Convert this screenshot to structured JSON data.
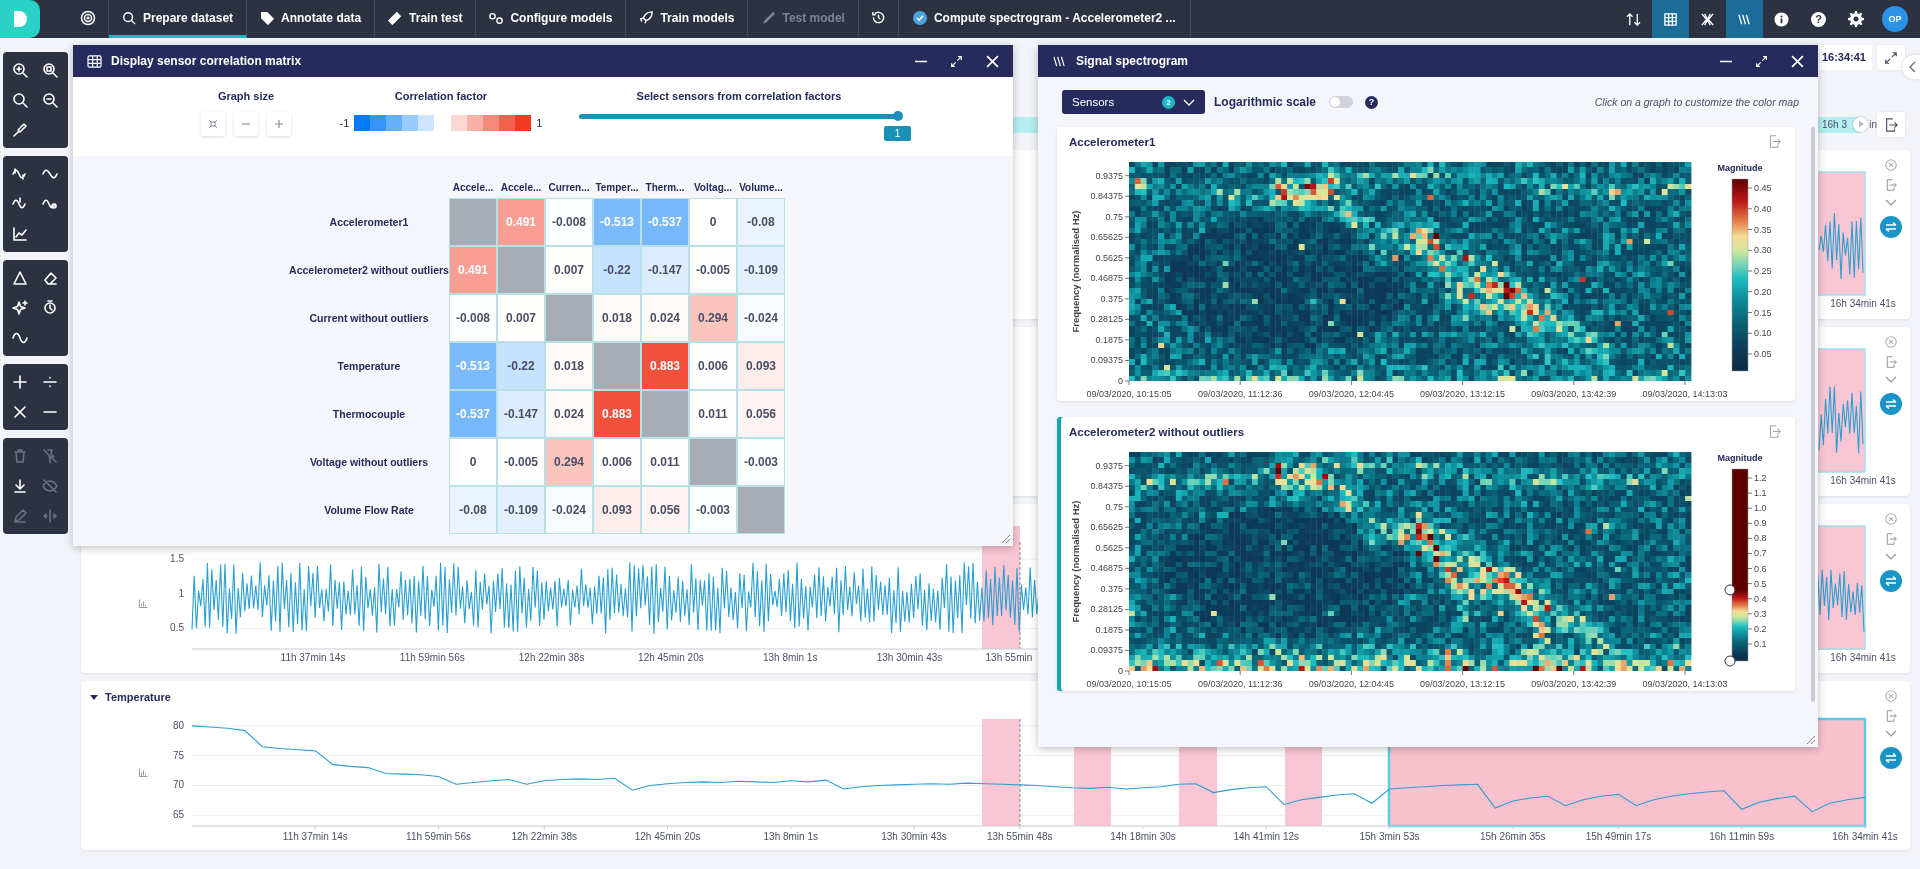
{
  "nav": {
    "items": [
      {
        "label": "Prepare dataset",
        "selected": true,
        "disabled": false
      },
      {
        "label": "Annotate data",
        "selected": false,
        "disabled": false
      },
      {
        "label": "Train test",
        "selected": false,
        "disabled": false
      },
      {
        "label": "Configure models",
        "selected": false,
        "disabled": false
      },
      {
        "label": "Train models",
        "selected": false,
        "disabled": false
      },
      {
        "label": "Test model",
        "selected": false,
        "disabled": true
      }
    ],
    "task": "Compute spectrogram - Accelerometer2 ...",
    "tools": [
      {
        "selected": false
      },
      {
        "selected": true
      },
      {
        "selected": false
      },
      {
        "selected": true
      }
    ],
    "help": "?",
    "avatar": "OP"
  },
  "toolbar": {
    "groups": [
      {
        "tools": [
          {
            "disabled": false
          },
          {
            "disabled": false
          },
          {
            "disabled": false
          },
          {
            "disabled": false
          },
          {
            "disabled": false
          }
        ]
      },
      {
        "tools": [
          {
            "disabled": false
          },
          {
            "disabled": false
          },
          {
            "disabled": false
          },
          {
            "disabled": false
          },
          {
            "disabled": false
          }
        ]
      },
      {
        "tools": [
          {
            "disabled": false
          },
          {
            "disabled": false
          },
          {
            "disabled": false
          },
          {
            "disabled": false
          },
          {
            "disabled": false
          }
        ]
      },
      {
        "tools": [
          {
            "disabled": false
          },
          {
            "disabled": false
          },
          {
            "disabled": false
          },
          {
            "disabled": false
          }
        ]
      },
      {
        "tools": [
          {
            "disabled": true
          },
          {
            "disabled": true
          },
          {
            "disabled": false
          },
          {
            "disabled": true
          },
          {
            "disabled": true
          },
          {
            "disabled": true
          }
        ]
      }
    ]
  },
  "header": {
    "date": "16:34:41",
    "timeline_labels": [
      "16h 3",
      "in"
    ],
    "timeline": {
      "level": 1
    }
  },
  "cards": [
    {
      "kind": "waveform",
      "end_label": "16h 34min 41s"
    },
    {
      "kind": "waveform",
      "end_label": "16h 34min 41s"
    },
    {
      "kind": "waveform",
      "y_labels": [
        "1.5",
        "1",
        "0.5"
      ],
      "x_labels": [
        "11h 37min 14s",
        "11h 59min 56s",
        "12h 22min 38s",
        "12h 45min 20s",
        "13h 8min 1s",
        "13h 30min 43s",
        "13h 55min"
      ],
      "end_label": "16h 34min 41s"
    },
    {
      "kind": "chart",
      "title": "Temperature",
      "expanded": true,
      "regions": [
        {
          "selected": false
        },
        {
          "selected": false
        },
        {
          "selected": false
        },
        {
          "selected": false
        },
        {
          "selected": true
        }
      ],
      "chart_data": {
        "type": "line",
        "ylim": [
          63.2,
          81.15
        ],
        "yticks": [
          80,
          75,
          70,
          65
        ],
        "grid": true,
        "categories": [
          null,
          null,
          null,
          null,
          null,
          null,
          null,
          "11h 37min 14s",
          null,
          null,
          null,
          null,
          null,
          null,
          "11h 59min 56s",
          null,
          null,
          null,
          null,
          null,
          "12h 22min 38s",
          null,
          null,
          null,
          null,
          null,
          null,
          "12h 45min 20s",
          null,
          null,
          null,
          null,
          null,
          null,
          "13h 8min 1s",
          null,
          null,
          null,
          null,
          null,
          null,
          "13h 30min 43s",
          null,
          null,
          null,
          null,
          null,
          "13h 55min 48s",
          null,
          null,
          null,
          null,
          null,
          null,
          "14h 18min 30s",
          null,
          null,
          null,
          null,
          null,
          null,
          "14h 41min 12s",
          null,
          null,
          null,
          null,
          null,
          null,
          "15h 3min 53s",
          null,
          null,
          null,
          null,
          null,
          null,
          "15h 26min 35s",
          null,
          null,
          null,
          null,
          null,
          "15h 49min 17s",
          null,
          null,
          null,
          null,
          null,
          null,
          "16h 11min 59s",
          null,
          null,
          null,
          null,
          null,
          null,
          "16h 34min 41s"
        ],
        "series": [
          {
            "values": [
              80,
              79.8,
              79.6,
              79.2,
              76.5,
              76.2,
              76,
              75.8,
              73.5,
              73.2,
              73,
              72,
              71.9,
              71.8,
              71.5,
              70.2,
              70.5,
              70.8,
              71,
              70.2,
              70.8,
              71,
              71.1,
              71,
              71.2,
              69.2,
              70,
              70.3,
              70.5,
              70.6,
              70.5,
              70.7,
              70.6,
              70.5,
              70.8,
              70.6,
              70.9,
              69.4,
              69.8,
              70,
              70.1,
              70.2,
              70.3,
              70.2,
              70.4,
              70.3,
              70.2,
              70.1,
              70,
              69.8,
              69.6,
              69.5,
              69.7,
              69.4,
              69.6,
              69.8,
              70.2,
              70.3,
              68.8,
              69.3,
              69.6,
              69.8,
              66.8,
              67.6,
              68,
              68.4,
              68.6,
              67,
              69.4,
              69.6,
              69.8,
              70,
              70.1,
              70.2,
              66.2,
              67.4,
              67.9,
              68.2,
              66.6,
              67.6,
              68.2,
              68.5,
              66.6,
              67.6,
              68.2,
              68.6,
              68.9,
              69.1,
              66,
              67.2,
              67.8,
              68.2,
              65.6,
              67,
              67.6,
              68
            ]
          }
        ]
      }
    }
  ],
  "correlation_window": {
    "title": "Display sensor correlation matrix",
    "graph_size_label": "Graph size",
    "factor_label": "Correlation factor",
    "legend_min": "-1",
    "legend_max": "1",
    "slider_label": "Select sensors from correlation factors",
    "slider": {
      "level": 1,
      "value": "1"
    },
    "columns": [
      "Accele...",
      "Accele...",
      "Curren...",
      "Temper...",
      "Therm...",
      "Voltag...",
      "Volume..."
    ],
    "rows": [
      {
        "label": "Accelerometer1",
        "cells": [
          null,
          "0.491",
          "-0.008",
          "-0.513",
          "-0.537",
          "0",
          "-0.08"
        ]
      },
      {
        "label": "Accelerometer2 without outliers",
        "cells": [
          "0.491",
          null,
          "0.007",
          "-0.22",
          "-0.147",
          "-0.005",
          "-0.109"
        ]
      },
      {
        "label": "Current without outliers",
        "cells": [
          "-0.008",
          "0.007",
          null,
          "0.018",
          "0.024",
          "0.294",
          "-0.024"
        ]
      },
      {
        "label": "Temperature",
        "cells": [
          "-0.513",
          "-0.22",
          "0.018",
          null,
          "0.883",
          "0.006",
          "0.093"
        ]
      },
      {
        "label": "Thermocouple",
        "cells": [
          "-0.537",
          "-0.147",
          "0.024",
          "0.883",
          null,
          "0.011",
          "0.056"
        ]
      },
      {
        "label": "Voltage without outliers",
        "cells": [
          "0",
          "-0.005",
          "0.294",
          "0.006",
          "0.011",
          null,
          "-0.003"
        ]
      },
      {
        "label": "Volume Flow Rate",
        "cells": [
          "-0.08",
          "-0.109",
          "-0.024",
          "0.093",
          "0.056",
          "-0.003",
          null
        ]
      }
    ]
  },
  "spectrogram_window": {
    "title": "Signal spectrogram",
    "sensors": {
      "label": "Sensors",
      "count": "2"
    },
    "log_scale": {
      "label": "Logarithmic scale",
      "on": false
    },
    "help": "?",
    "hint": "Click on a graph to customize the color map",
    "graphs": [
      {
        "title": "Accelerometer1",
        "selected": false,
        "y_label": "Frequency (normalised Hz)",
        "y_ticks": [
          "0.9375",
          "0.84375",
          "0.75",
          "0.65625",
          "0.5625",
          "0.46875",
          "0.375",
          "0.28125",
          "0.1875",
          "0.09375",
          "0"
        ],
        "x_ticks": [
          "09/03/2020, 10:15:05",
          "09/03/2020, 11:12:36",
          "09/03/2020, 12:04:45",
          "09/03/2020, 13:12:15",
          "09/03/2020, 13:42:39",
          "09/03/2020, 14:13:03"
        ],
        "colorbar": {
          "title": "Magnitude",
          "ticks": [
            "0.45",
            "0.40",
            "0.35",
            "0.30",
            "0.25",
            "0.20",
            "0.15",
            "0.10",
            "0.05"
          ]
        }
      },
      {
        "title": "Accelerometer2 without outliers",
        "selected": true,
        "y_label": "Frequency (normalised Hz)",
        "y_ticks": [
          "0.9375",
          "0.84375",
          "0.75",
          "0.65625",
          "0.5625",
          "0.46875",
          "0.375",
          "0.28125",
          "0.1875",
          "0.09375",
          "0"
        ],
        "x_ticks": [
          "09/03/2020, 10:15:05",
          "09/03/2020, 11:12:36",
          "09/03/2020, 12:04:45",
          "09/03/2020, 13:12:15",
          "09/03/2020, 13:42:39",
          "09/03/2020, 14:13:03"
        ],
        "colorbar": {
          "title": "Magnitude",
          "ticks": [
            "1.2",
            "1.1",
            "1.0",
            "0.9",
            "0.8",
            "0.7",
            "0.6",
            "0.5",
            "0.4",
            "0.3",
            "0.2",
            "0.1"
          ],
          "handles": [
            {
              "level": 0.37
            },
            {
              "level": 0
            }
          ]
        }
      }
    ]
  }
}
